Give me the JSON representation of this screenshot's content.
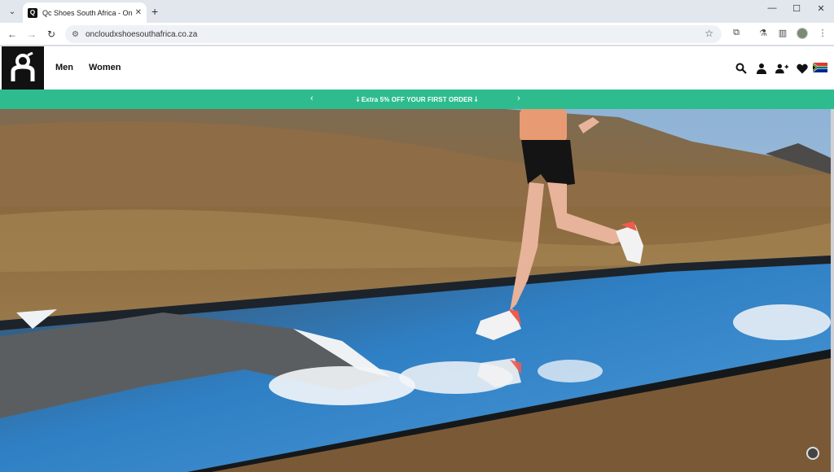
{
  "browser": {
    "tab_title": "Qc Shoes South Africa - On Ru",
    "tab_close": "✕",
    "new_tab": "+",
    "url": "oncloudxshoesouthafrica.co.za"
  },
  "site": {
    "nav": {
      "men": "Men",
      "women": "Women"
    },
    "icons": [
      "search-icon",
      "account-icon",
      "register-icon",
      "wishlist-icon",
      "flag-icon"
    ],
    "promo": {
      "text": "Extra 5% OFF YOUR FIRST ORDER",
      "prev": "‹",
      "next": "›"
    }
  },
  "colors": {
    "promo_bg": "#2ebc8f",
    "logo_bg": "#111111"
  }
}
